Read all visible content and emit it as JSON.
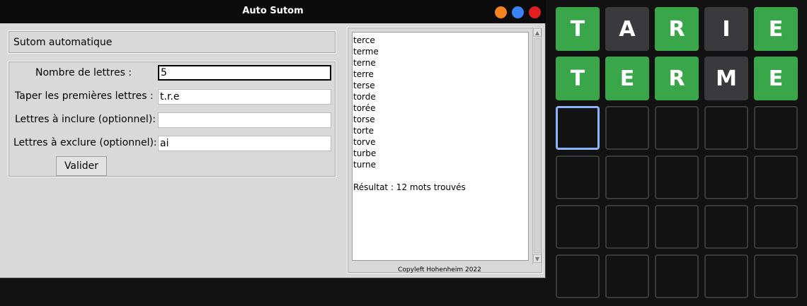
{
  "window": {
    "title": "Auto Sutom"
  },
  "header": {
    "label": "Sutom automatique"
  },
  "form": {
    "letters_count_label": "Nombre de lettres :",
    "letters_count_value": "5",
    "first_letters_label": "Taper les premières lettres :",
    "first_letters_value": "t.r.e",
    "include_label": "Lettres à inclure (optionnel):",
    "include_value": "",
    "exclude_label": "Lettres à exclure (optionnel):",
    "exclude_value": "ai",
    "submit_label": "Valider"
  },
  "results": {
    "words": [
      "terce",
      "terme",
      "terne",
      "terre",
      "terse",
      "torde",
      "torée",
      "torse",
      "torte",
      "torve",
      "turbe",
      "turne"
    ],
    "summary": "Résultat : 12 mots trouvés"
  },
  "footer": {
    "copyleft": "Copyleft Hohenheim 2022"
  },
  "grid": {
    "rows": [
      [
        {
          "letter": "T",
          "state": "correct"
        },
        {
          "letter": "A",
          "state": "absent"
        },
        {
          "letter": "R",
          "state": "correct"
        },
        {
          "letter": "I",
          "state": "absent"
        },
        {
          "letter": "E",
          "state": "correct"
        }
      ],
      [
        {
          "letter": "T",
          "state": "correct"
        },
        {
          "letter": "E",
          "state": "correct"
        },
        {
          "letter": "R",
          "state": "correct"
        },
        {
          "letter": "M",
          "state": "absent"
        },
        {
          "letter": "E",
          "state": "correct"
        }
      ],
      [
        {
          "letter": "",
          "state": "active"
        },
        {
          "letter": "",
          "state": "empty"
        },
        {
          "letter": "",
          "state": "empty"
        },
        {
          "letter": "",
          "state": "empty"
        },
        {
          "letter": "",
          "state": "empty"
        }
      ],
      [
        {
          "letter": "",
          "state": "empty"
        },
        {
          "letter": "",
          "state": "empty"
        },
        {
          "letter": "",
          "state": "empty"
        },
        {
          "letter": "",
          "state": "empty"
        },
        {
          "letter": "",
          "state": "empty"
        }
      ],
      [
        {
          "letter": "",
          "state": "empty"
        },
        {
          "letter": "",
          "state": "empty"
        },
        {
          "letter": "",
          "state": "empty"
        },
        {
          "letter": "",
          "state": "empty"
        },
        {
          "letter": "",
          "state": "empty"
        }
      ],
      [
        {
          "letter": "",
          "state": "empty"
        },
        {
          "letter": "",
          "state": "empty"
        },
        {
          "letter": "",
          "state": "empty"
        },
        {
          "letter": "",
          "state": "empty"
        },
        {
          "letter": "",
          "state": "empty"
        }
      ]
    ]
  },
  "colors": {
    "correct": "#3aa64a",
    "absent": "#3a3a3c",
    "active_border": "#8ab4f8",
    "close_button": "#e0201e",
    "minimize_button": "#f5831f",
    "maximize_button": "#3b82f6"
  }
}
